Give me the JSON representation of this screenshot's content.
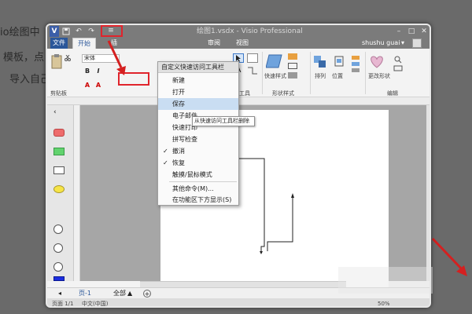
{
  "background_text": {
    "line1": "io绘图中",
    "line2": "模板，点",
    "line3": "导入自己"
  },
  "window": {
    "title": "绘图1.vsdx - Visio Professional",
    "minimize_icon": "minimize-icon",
    "maximize_icon": "maximize-icon",
    "close_icon": "close-icon"
  },
  "quick_access": {
    "visio_icon": "V",
    "save_icon": "save-icon",
    "undo_icon": "undo-icon",
    "customize_icon": "chevron-down-icon",
    "customize_glyph": "≡"
  },
  "tabs": [
    {
      "label": "文件"
    },
    {
      "label": "开始"
    },
    {
      "label": "插"
    },
    {
      "label": "审阅"
    },
    {
      "label": "视图"
    }
  ],
  "user": {
    "name": "shushu guai",
    "arrow": "▾"
  },
  "ribbon": {
    "font_name": "宋体",
    "bold": "B",
    "italic": "I",
    "font_color": "A",
    "clipboard_label": "剪贴板",
    "tools_label": "工具",
    "shape_style_label": "形状样式",
    "edit_label": "编辑",
    "quick_style_label": "快速样式",
    "arrange_label": "排列",
    "position_label": "位置",
    "change_shape_label": "更改形状"
  },
  "menu": {
    "header": "自定义快速访问工具栏",
    "items": [
      {
        "label": "新建",
        "checked": false
      },
      {
        "label": "打开",
        "checked": false
      },
      {
        "label": "保存",
        "checked": false
      },
      {
        "label": "电子邮件",
        "checked": false
      },
      {
        "label": "快速打印",
        "checked": false
      },
      {
        "label": "拼写检查",
        "checked": false
      },
      {
        "label": "撤消",
        "checked": true
      },
      {
        "label": "恢复",
        "checked": true
      },
      {
        "label": "触摸/鼠标模式",
        "checked": false
      },
      {
        "label": "其他命令(M)...",
        "checked": false
      },
      {
        "label": "在功能区下方显示(S)",
        "checked": false
      }
    ],
    "check_glyph": "✓"
  },
  "tooltip": "从快速访问工具栏删除",
  "page_bar": {
    "page_tab": "页-1",
    "all_label": "全部",
    "all_arrow": "▲",
    "add_page": "+"
  },
  "status": {
    "page": "页面 1/1",
    "language": "中文(中国)",
    "zoom": "50%"
  },
  "colors": {
    "accent": "#2b579a",
    "highlight_box": "#e0242c"
  }
}
